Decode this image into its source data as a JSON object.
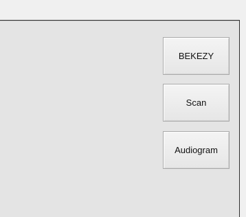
{
  "buttons": {
    "bekezy": "BEKEZY",
    "scan": "Scan",
    "audiogram": "Audiogram"
  }
}
